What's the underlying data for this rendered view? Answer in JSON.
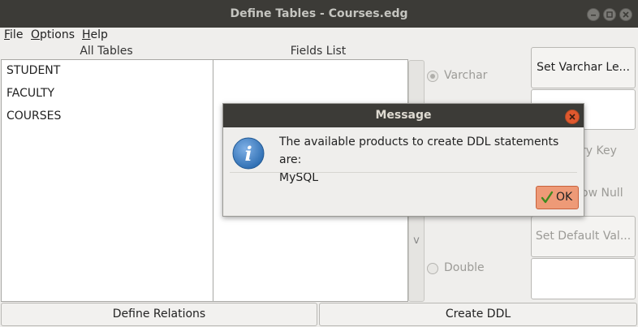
{
  "window": {
    "title": "Define Tables - Courses.edg"
  },
  "menu": {
    "file": {
      "mnemonic": "F",
      "rest": "ile"
    },
    "options": {
      "mnemonic": "O",
      "rest": "ptions"
    },
    "help": {
      "mnemonic": "H",
      "rest": "elp"
    }
  },
  "tables_panel": {
    "header": "All Tables",
    "items": [
      "STUDENT",
      "FACULTY",
      "COURSES"
    ]
  },
  "fields_panel": {
    "header": "Fields List"
  },
  "scroll_arrow": "v",
  "options_panel": {
    "radio_varchar": "Varchar",
    "radio_double": "Double",
    "set_varchar_button": "Set Varchar Le...",
    "primary_key_partial": "ry Key",
    "allow_null_partial": "ow Null",
    "set_default_button": "Set Default Val..."
  },
  "bottom": {
    "define_relations": "Define Relations",
    "create_ddl": "Create DDL"
  },
  "dialog": {
    "title": "Message",
    "message_line1": "The available products to create DDL statements are:",
    "message_line2": "MySQL",
    "ok_label": "OK",
    "icon": "info-icon"
  },
  "colors": {
    "titlebar": "#3c3b37",
    "close_accent": "#e0582e",
    "ok_accent": "#ee9a77",
    "info_blue": "#2f6fb3"
  }
}
